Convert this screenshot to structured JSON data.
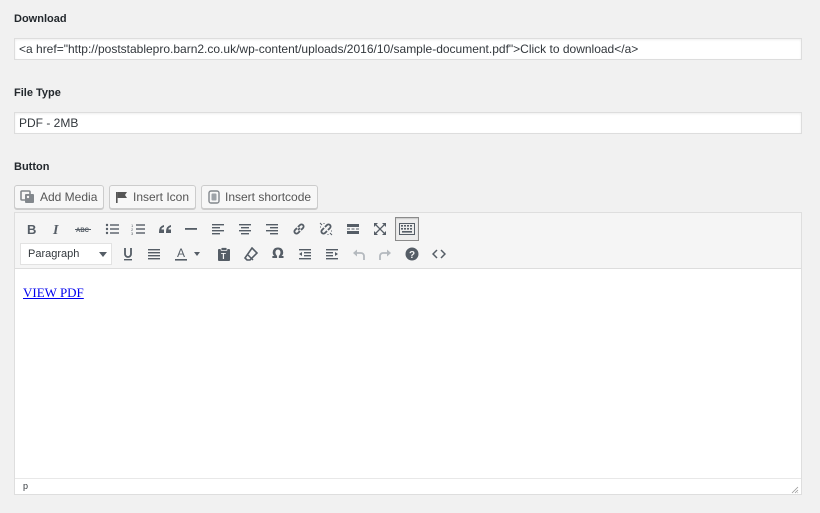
{
  "download": {
    "label": "Download",
    "value": "<a href=\"http://poststablepro.barn2.co.uk/wp-content/uploads/2016/10/sample-document.pdf\">Click to download</a>"
  },
  "file_type": {
    "label": "File Type",
    "value": "PDF - 2MB"
  },
  "button": {
    "label": "Button"
  },
  "media_buttons": {
    "add_media": "Add Media",
    "insert_icon": "Insert Icon",
    "insert_shortcode": "Insert shortcode"
  },
  "toolbar": {
    "row1": [
      "bold-icon",
      "italic-icon",
      "strikethrough-icon",
      "bulleted-list-icon",
      "numbered-list-icon",
      "blockquote-icon",
      "horizontal-line-icon",
      "align-left-icon",
      "align-center-icon",
      "align-right-icon",
      "insert-link-icon",
      "remove-link-icon",
      "read-more-icon",
      "fullscreen-icon",
      "toolbar-toggle-icon"
    ],
    "row2": [
      "underline-icon",
      "justify-icon",
      "text-color-icon",
      "paste-as-text-icon",
      "clear-formatting-icon",
      "special-character-icon",
      "outdent-icon",
      "indent-icon",
      "undo-icon",
      "redo-icon",
      "help-icon",
      "code-icon"
    ],
    "format_select": "Paragraph",
    "text_color_letter": "A",
    "special_char": "Ω"
  },
  "editor": {
    "content_link_text": "VIEW PDF",
    "status_path": "p"
  }
}
